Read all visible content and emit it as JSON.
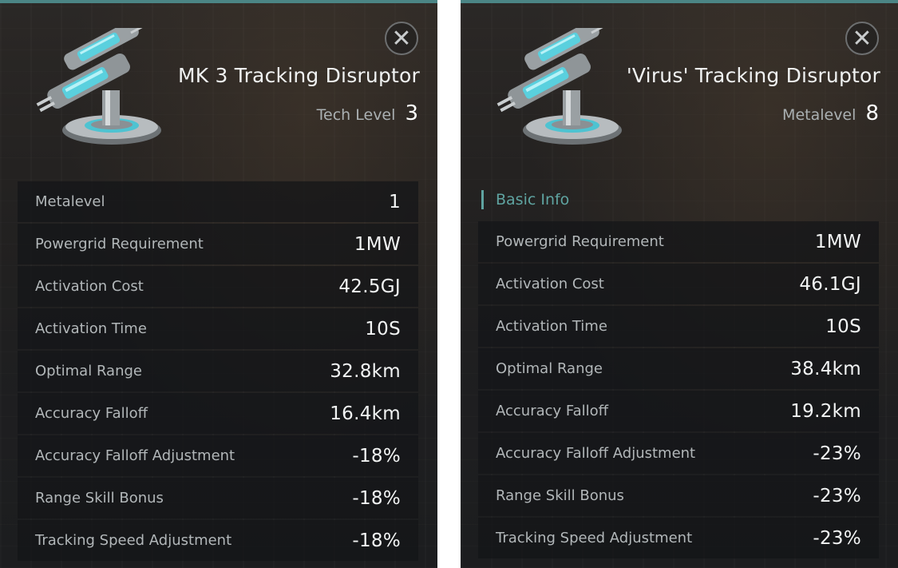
{
  "panels": [
    {
      "title": "MK 3 Tracking Disruptor",
      "level_label": "Tech Level",
      "level_value": "3",
      "close_icon": "close-icon",
      "item_icon": "tracking-disruptor-icon",
      "rows": [
        {
          "label": "Metalevel",
          "value": "1"
        },
        {
          "label": "Powergrid Requirement",
          "value": "1MW"
        },
        {
          "label": "Activation Cost",
          "value": "42.5GJ"
        },
        {
          "label": "Activation Time",
          "value": "10S"
        },
        {
          "label": "Optimal Range",
          "value": "32.8km"
        },
        {
          "label": "Accuracy Falloff",
          "value": "16.4km"
        },
        {
          "label": "Accuracy Falloff Adjustment",
          "value": "-18%"
        },
        {
          "label": "Range Skill Bonus",
          "value": "-18%"
        },
        {
          "label": "Tracking Speed Adjustment",
          "value": "-18%"
        }
      ]
    },
    {
      "title": "'Virus' Tracking Disruptor",
      "level_label": "Metalevel",
      "level_value": "8",
      "close_icon": "close-icon",
      "item_icon": "tracking-disruptor-icon",
      "section": "Basic Info",
      "rows": [
        {
          "label": "Powergrid Requirement",
          "value": "1MW"
        },
        {
          "label": "Activation Cost",
          "value": "46.1GJ"
        },
        {
          "label": "Activation Time",
          "value": "10S"
        },
        {
          "label": "Optimal Range",
          "value": "38.4km"
        },
        {
          "label": "Accuracy Falloff",
          "value": "19.2km"
        },
        {
          "label": "Accuracy Falloff Adjustment",
          "value": "-23%"
        },
        {
          "label": "Range Skill Bonus",
          "value": "-23%"
        },
        {
          "label": "Tracking Speed Adjustment",
          "value": "-23%"
        }
      ]
    }
  ],
  "colors": {
    "accent": "#4b8585",
    "section": "#5fa4a1",
    "row_bg": "#141517",
    "label": "#b2b7b9",
    "value": "#f2f4f4"
  }
}
